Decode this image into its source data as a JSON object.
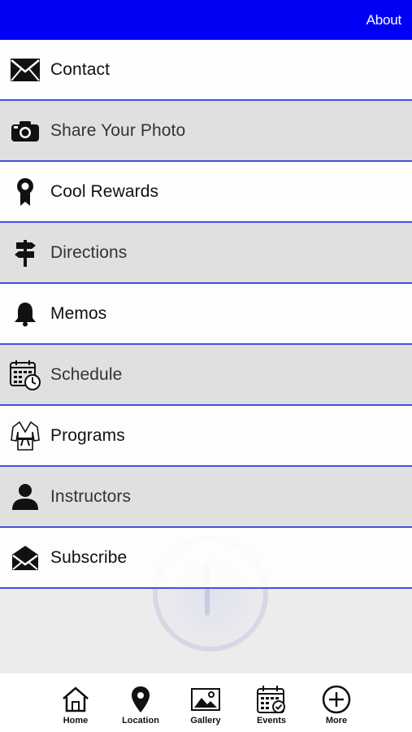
{
  "header": {
    "about_label": "About"
  },
  "menu": {
    "items": [
      {
        "label": "Contact",
        "icon": "envelope-icon"
      },
      {
        "label": "Share Your Photo",
        "icon": "camera-icon"
      },
      {
        "label": "Cool Rewards",
        "icon": "award-ribbon-icon"
      },
      {
        "label": "Directions",
        "icon": "signpost-icon"
      },
      {
        "label": "Memos",
        "icon": "bell-icon"
      },
      {
        "label": "Schedule",
        "icon": "calendar-clock-icon"
      },
      {
        "label": "Programs",
        "icon": "martial-arts-uniform-icon"
      },
      {
        "label": "Instructors",
        "icon": "person-icon"
      },
      {
        "label": "Subscribe",
        "icon": "open-envelope-icon"
      }
    ]
  },
  "tabbar": {
    "items": [
      {
        "label": "Home",
        "icon": "home-icon"
      },
      {
        "label": "Location",
        "icon": "map-pin-icon"
      },
      {
        "label": "Gallery",
        "icon": "image-icon"
      },
      {
        "label": "Events",
        "icon": "calendar-icon"
      },
      {
        "label": "More",
        "icon": "plus-circle-icon"
      }
    ]
  },
  "colors": {
    "header": "#0000f5",
    "divider": "#4a4fe0",
    "text": "#111111"
  }
}
